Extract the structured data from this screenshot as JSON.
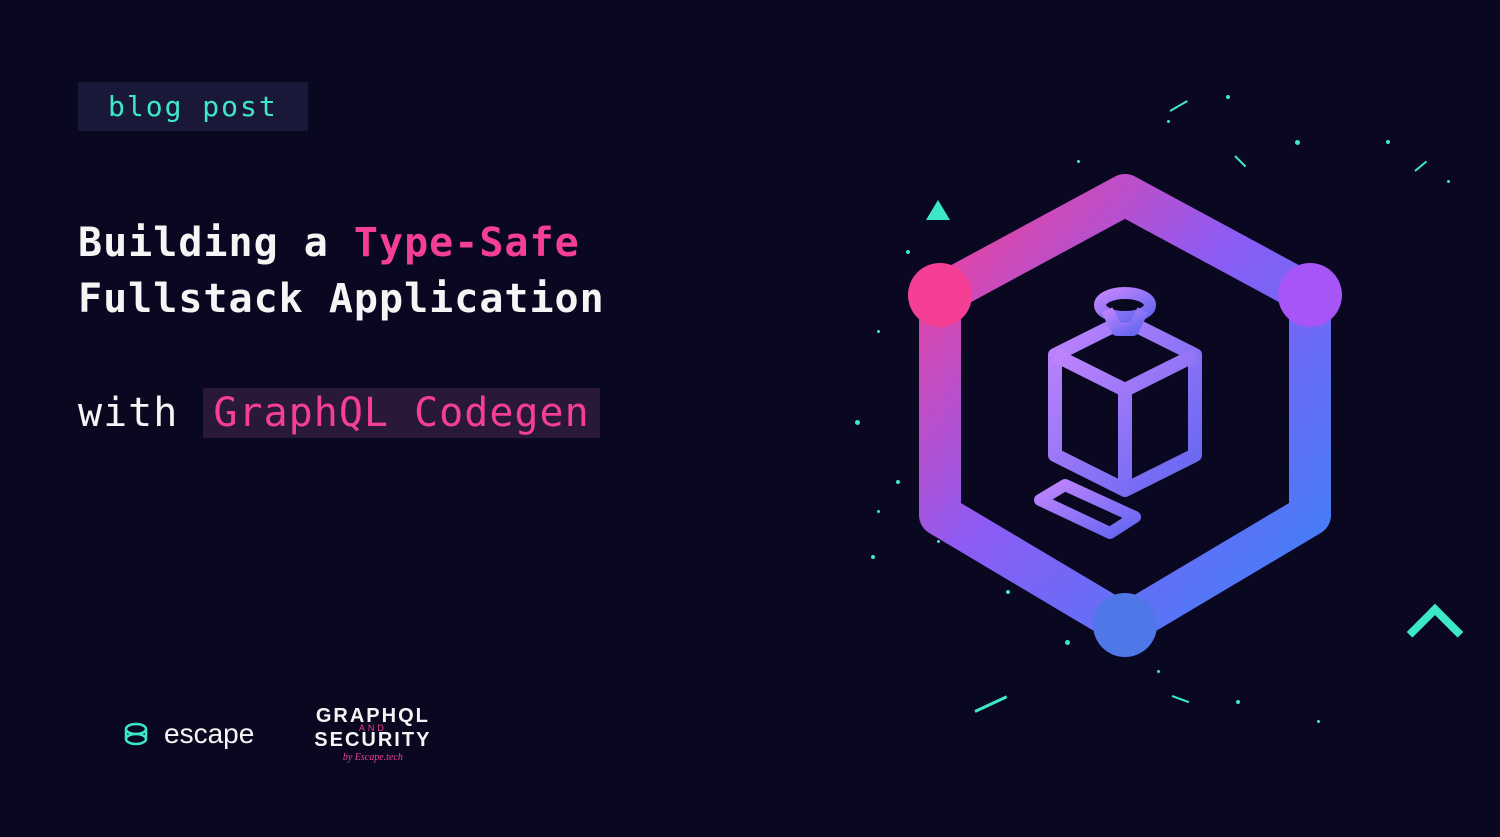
{
  "badge": {
    "label": "blog post"
  },
  "title": {
    "prefix": "Building a ",
    "highlight": "Type-Safe",
    "line2": "Fullstack Application"
  },
  "subtitle": {
    "prefix": "with ",
    "highlight": "GraphQL Codegen"
  },
  "logos": {
    "escape": {
      "text": "escape"
    },
    "graphql_security": {
      "line1": "GRAPHQL",
      "middle": "AND",
      "line2": "SECURITY",
      "byline": "by Escape.tech"
    }
  },
  "colors": {
    "background": "#0a0820",
    "accent_teal": "#3de8c8",
    "accent_pink": "#f43f95",
    "accent_purple": "#8b5cf6",
    "accent_blue": "#3b82f6",
    "text": "#f5f5f5",
    "badge_bg": "#1a1838"
  }
}
